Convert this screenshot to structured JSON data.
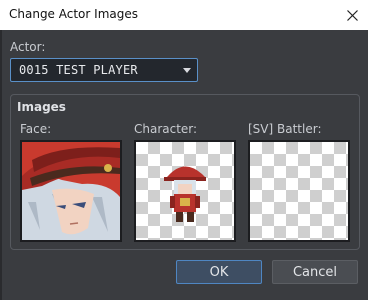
{
  "window": {
    "title": "Change Actor Images",
    "close_icon": "close-icon"
  },
  "actor": {
    "label": "Actor:",
    "selected": "0015 TEST PLAYER"
  },
  "images": {
    "title": "Images",
    "face_label": "Face:",
    "character_label": "Character:",
    "battler_label": "[SV] Battler:"
  },
  "buttons": {
    "ok": "OK",
    "cancel": "Cancel"
  },
  "colors": {
    "accent": "#5a90c8",
    "panel": "#3a3c40",
    "hat_red": "#b8322c"
  }
}
